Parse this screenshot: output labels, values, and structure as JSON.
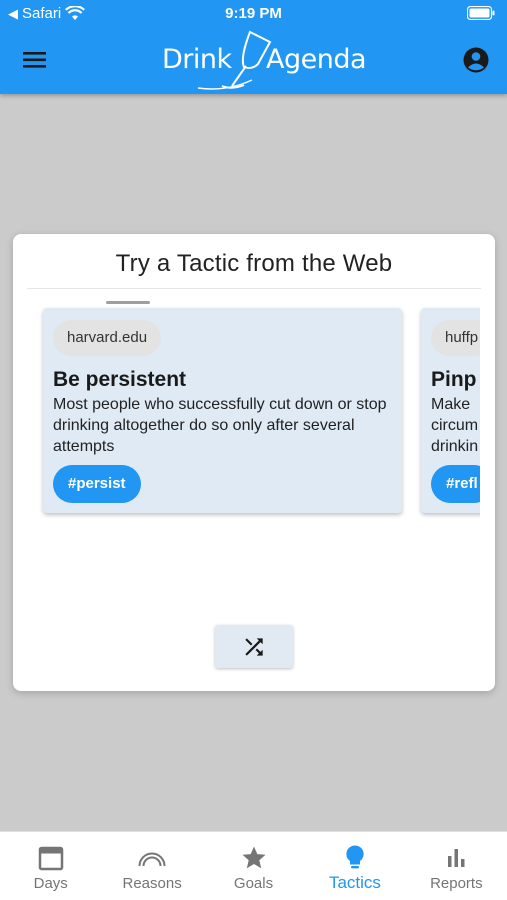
{
  "status": {
    "carrier": "Safari",
    "time": "9:19 PM"
  },
  "appbar": {
    "logo_word1": "Drink",
    "logo_word2": "Agenda",
    "menu_icon": "hamburger-menu-icon",
    "account_icon": "account-circle-icon"
  },
  "dialog": {
    "title": "Try a Tactic from the Web",
    "tactics": [
      {
        "source": "harvard.edu",
        "title": "Be persistent",
        "description": "Most people who successfully cut down or stop drinking altogether do so only after several attempts",
        "tag": "#persist"
      },
      {
        "source": "huffp",
        "title": "Pinp",
        "description": "Make circum drinkin",
        "tag": "#refl"
      }
    ],
    "shuffle_icon": "shuffle-icon"
  },
  "bottom_nav": {
    "active": "Tactics",
    "items": [
      {
        "label": "Days",
        "icon": "calendar-icon"
      },
      {
        "label": "Reasons",
        "icon": "rainbow-icon"
      },
      {
        "label": "Goals",
        "icon": "star-icon"
      },
      {
        "label": "Tactics",
        "icon": "lightbulb-icon"
      },
      {
        "label": "Reports",
        "icon": "bar-chart-icon"
      }
    ]
  },
  "colors": {
    "primary": "#2196f3",
    "background": "#cbcbcb",
    "card": "#dfeaf5",
    "inactive": "#757575"
  }
}
